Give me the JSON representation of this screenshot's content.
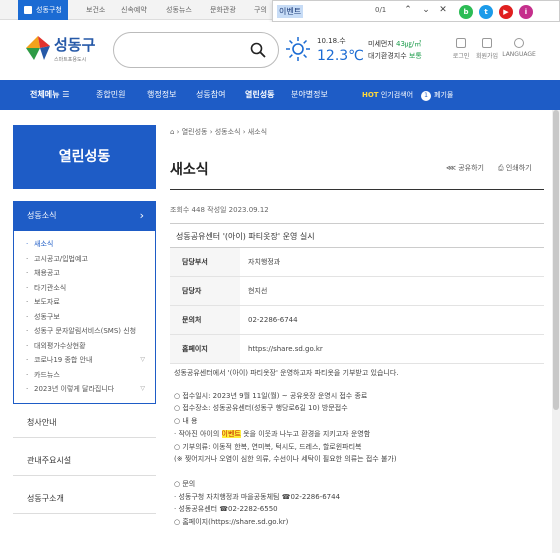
{
  "topbar": {
    "tabs": [
      "성동구청",
      "보건소",
      "신속예약",
      "성동뉴스",
      "문화관광",
      "구의"
    ]
  },
  "findbar": {
    "query": "이벤트",
    "count": "0/1",
    "up_icon": "chevron-up-icon",
    "down_icon": "chevron-down-icon",
    "close_icon": "close-icon"
  },
  "social": [
    "b",
    "t",
    "▶",
    "i"
  ],
  "header": {
    "logo_name": "성동구",
    "logo_sub": "스마트포용도시",
    "weather_date": "10.18.수",
    "temp": "12.3℃",
    "air_label1": "미세먼지",
    "air_val1": "43㎍/㎥",
    "air_label2": "대기환경지수",
    "air_val2": "보통",
    "util": [
      "로그인",
      "회원가입",
      "LANGUAGE"
    ]
  },
  "gnb": {
    "all_menu": "전체메뉴",
    "menus": [
      "종합민원",
      "행정정보",
      "성동참여",
      "열린성동",
      "분야별정보"
    ],
    "hot_label": "HOT",
    "hot_text": "인기검색어",
    "hot_num": "1",
    "hot_item": "폐기물"
  },
  "side": {
    "title": "열린성동",
    "section": "성동소식",
    "items": [
      "새소식",
      "고시공고/입법예고",
      "채용공고",
      "타기관소식",
      "보도자료",
      "성동구보",
      "성동구 문자알림서비스(SMS) 신청",
      "대외평가수상현황",
      "코로나19 종합 안내",
      "카드뉴스",
      "2023년 이렇게 달라집니다"
    ],
    "groups": [
      "청사안내",
      "관내주요시설",
      "성동구소개"
    ]
  },
  "content": {
    "breadcrumb": [
      "열린성동",
      "성동소식",
      "새소식"
    ],
    "page_title": "새소식",
    "share": "공유하기",
    "print": "인쇄하기",
    "meta": "조회수 448 작성일 2023.09.12",
    "notice_title": "성동공유센터 '(아이) 파티옷장' 운영 실시",
    "info": [
      {
        "k": "담당부서",
        "v": "자치행정과"
      },
      {
        "k": "담당자",
        "v": "현지선"
      },
      {
        "k": "문의처",
        "v": "02-2286-6744"
      },
      {
        "k": "홈페이지",
        "v": "https://share.sd.go.kr"
      }
    ],
    "body_intro": "성동공유센터에서 '(아이) 파티옷장' 운영하고자 파티옷을 기부받고 있습니다.",
    "body_lines": [
      "○ 접수일시: 2023년 9월 11일(월) ~ 공유옷장 운영시 접수 종료",
      "○ 접수장소: 성동공유센터(성동구 행당로6길 10) 방문접수",
      "○ 내 용",
      "○ 기부의류: 이동적 한복, 연미복, 턱시도, 드레스, 할로윈파티복",
      "(※ 찢어지거나 오염이 심한 의류, 수선이나 세탁이 필요한 의류는 접수 불가)"
    ],
    "line_pre": "· 작아진 아이의 ",
    "line_mark": "이벤트",
    "line_post": " 옷을 이웃과 나누고 환경을 지키고자 운영함",
    "contact": [
      "○ 문의",
      "· 성동구청 자치행정과 마을공동체팀 ☎02-2286-6744",
      "· 성동공유센터 ☎02-2282-6550",
      "○ 홈페이지(https://share.sd.go.kr)"
    ]
  }
}
